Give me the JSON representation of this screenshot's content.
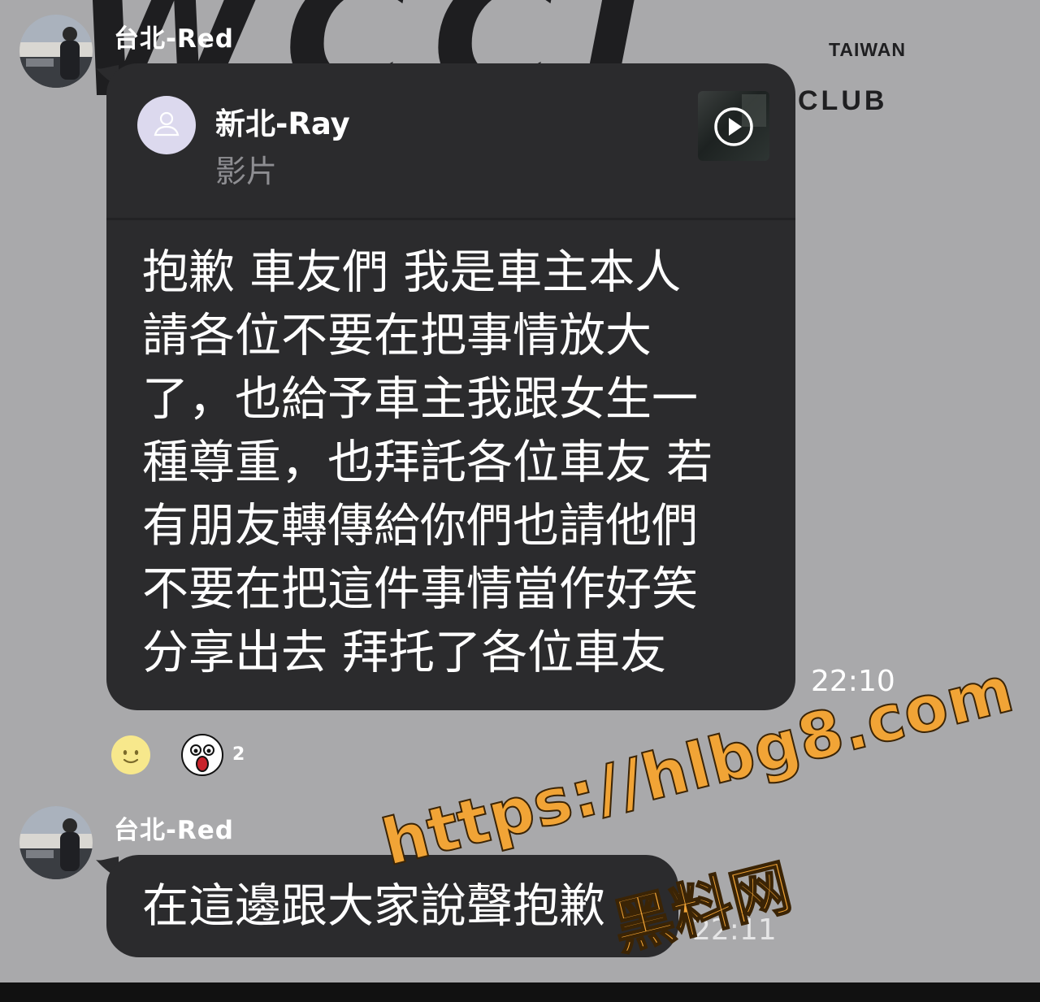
{
  "background_logo": {
    "region": "TAIWAN",
    "club": "CLUB"
  },
  "messages": [
    {
      "sender": "台北-Red",
      "reply": {
        "name": "新北-Ray",
        "type": "影片"
      },
      "lines": [
        "抱歉  車友們  我是車主本人",
        "請各位不要在把事情放大",
        "了，也給予車主我跟女生一",
        "種尊重，也拜託各位車友 若",
        "有朋友轉傳給你們也請他們",
        "不要在把這件事情當作好笑",
        "分享出去   拜托了各位車友"
      ],
      "time": "22:10",
      "reactions": [
        {
          "icon": "smiley-face-icon",
          "count": ""
        },
        {
          "icon": "shocked-face-icon",
          "count": "2"
        }
      ]
    },
    {
      "sender": "台北-Red",
      "text": "在這邊跟大家說聲抱歉",
      "time": "22:11"
    }
  ],
  "watermark": {
    "url": "https://hlbg8.com",
    "label": "黑料网"
  },
  "colors": {
    "background": "#a9a9ab",
    "bubble": "#2b2b2d",
    "watermark": "#f1a436"
  }
}
